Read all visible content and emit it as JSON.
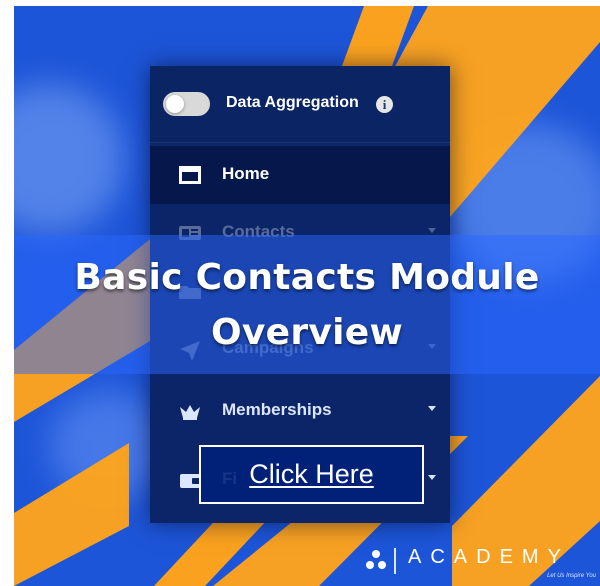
{
  "menu": {
    "toggle_label": "Data Aggregation",
    "info_symbol": "i",
    "items": [
      {
        "label": "Home",
        "icon": "home-icon",
        "active": true,
        "chevron": false,
        "faded": false
      },
      {
        "label": "Contacts",
        "icon": "contacts-icon",
        "active": false,
        "chevron": true,
        "faded": true
      },
      {
        "label": "",
        "icon": "folder-icon",
        "active": false,
        "chevron": false,
        "faded": true
      },
      {
        "label": "Campaigns",
        "icon": "campaigns-icon",
        "active": false,
        "chevron": true,
        "faded": true
      },
      {
        "label": "Memberships",
        "icon": "crown-icon",
        "active": false,
        "chevron": true,
        "faded": false
      },
      {
        "label": "Fi",
        "icon": "wallet-icon",
        "active": false,
        "chevron": true,
        "faded": false
      }
    ]
  },
  "headline": {
    "line1": "Basic Contacts Module",
    "line2": "Overview"
  },
  "cta": {
    "label": "Click Here"
  },
  "brand": {
    "name": "ACADEMY",
    "tagline": "Let Us Inspire You"
  },
  "colors": {
    "background": "#1D55D8",
    "accent_stripe": "#FFA41B",
    "menu_panel": "#0C2468",
    "active_row": "#06184B",
    "cta_border": "#FFFFFF"
  }
}
